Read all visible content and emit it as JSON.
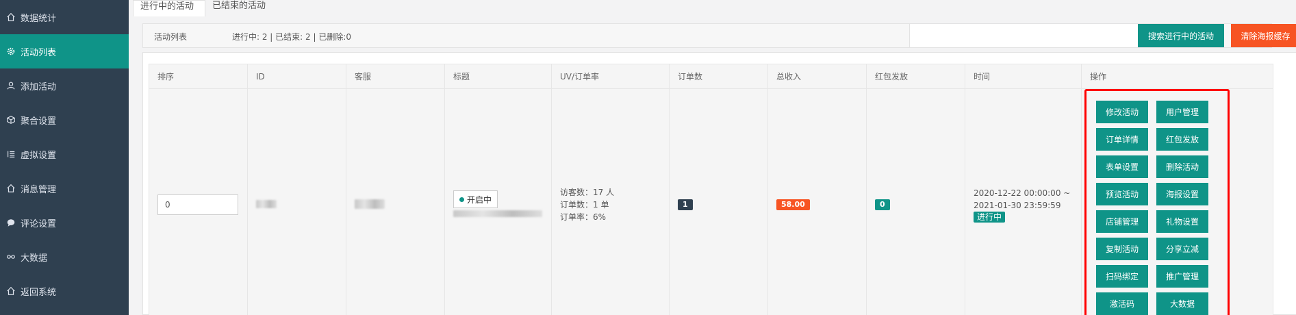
{
  "sidebar": {
    "items": [
      {
        "label": "数据统计",
        "icon": "home-icon"
      },
      {
        "label": "活动列表",
        "icon": "gear-icon",
        "active": true
      },
      {
        "label": "添加活动",
        "icon": "user-icon"
      },
      {
        "label": "聚合设置",
        "icon": "cube-icon"
      },
      {
        "label": "虚拟设置",
        "icon": "list-icon"
      },
      {
        "label": "消息管理",
        "icon": "home-icon"
      },
      {
        "label": "评论设置",
        "icon": "chat-icon"
      },
      {
        "label": "大数据",
        "icon": "link-icon"
      },
      {
        "label": "返回系统",
        "icon": "home-icon"
      }
    ]
  },
  "tabs": [
    "进行中的活动",
    "已结束的活动"
  ],
  "toolbar": {
    "label": "活动列表",
    "stats": "进行中: 2 | 已结束: 2 | 已删除:0",
    "search_button": "搜索进行中的活动",
    "clear_button": "清除海报缓存"
  },
  "table": {
    "columns": [
      "排序",
      "ID",
      "客服",
      "标题",
      "UV/订单率",
      "订单数",
      "总收入",
      "红包发放",
      "时间",
      "操作"
    ],
    "row": {
      "sort_value": "0",
      "status_chip": "开启中",
      "uv_visitors": "访客数：17 人",
      "uv_orders": "订单数：1 单",
      "uv_rate": "订单率：6%",
      "order_count": "1",
      "revenue": "58.00",
      "red_packet": "0",
      "time_start": "2020-12-22 00:00:00 ~",
      "time_end": "2021-01-30 23:59:59",
      "status": "进行中"
    },
    "actions": [
      "修改活动",
      "用户管理",
      "订单详情",
      "红包发放",
      "表单设置",
      "删除活动",
      "预览活动",
      "海报设置",
      "店铺管理",
      "礼物设置",
      "复制活动",
      "分享立减",
      "扫码绑定",
      "推广管理",
      "激活码",
      "大数据"
    ]
  },
  "colors": {
    "primary": "#0f9488",
    "sidebar": "#2f4050",
    "danger": "#f75423",
    "highlight": "#ff0000"
  }
}
